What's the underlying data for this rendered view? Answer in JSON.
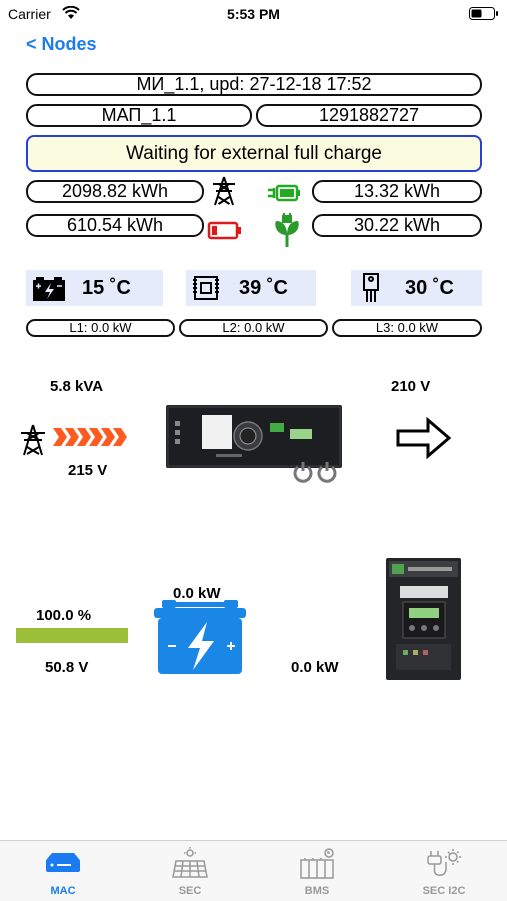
{
  "status_bar": {
    "carrier": "Carrier",
    "time": "5:53 PM"
  },
  "nav": {
    "back_label": "< Nodes"
  },
  "header": {
    "title": "МИ_1.1, upd: 27-12-18 17:52",
    "device": "МАП_1.1",
    "serial": "1291882727",
    "status": "Waiting for external full charge"
  },
  "energy": {
    "grid_consumed": "2098.82 kWh",
    "charged": "13.32 kWh",
    "battery_out": "610.54 kWh",
    "green": "30.22 kWh"
  },
  "temperatures": {
    "battery": "15 ˚C",
    "transformer": "39 ˚C",
    "transistor": "30 ˚C"
  },
  "lines": {
    "l1": "L1: 0.0 kW",
    "l2": "L2: 0.0 kW",
    "l3": "L3: 0.0 kW"
  },
  "power_flow": {
    "input_power": "5.8 kVA",
    "input_voltage": "215 V",
    "output_voltage": "210 V",
    "battery_soc": "100.0 %",
    "battery_soc_fraction": 1.0,
    "battery_voltage": "50.8 V",
    "battery_power": "0.0 kW",
    "controller_power": "0.0 kW"
  },
  "tabs": [
    {
      "label": "MAC",
      "icon": "inverter-icon",
      "active": true
    },
    {
      "label": "SEC",
      "icon": "solar-panel-icon",
      "active": false
    },
    {
      "label": "BMS",
      "icon": "battery-pack-icon",
      "active": false
    },
    {
      "label": "SEC I2C",
      "icon": "plug-sun-icon",
      "active": false
    }
  ],
  "colors": {
    "accent": "#1a7cf0",
    "status_border": "#2a3fd4",
    "status_bg": "#fbfbe0",
    "temp_bg": "#e5ebfb",
    "flow_arrow": "#ff5a1f",
    "battery_bar": "#9cbf3a",
    "battery_icon": "#1a86e6"
  }
}
